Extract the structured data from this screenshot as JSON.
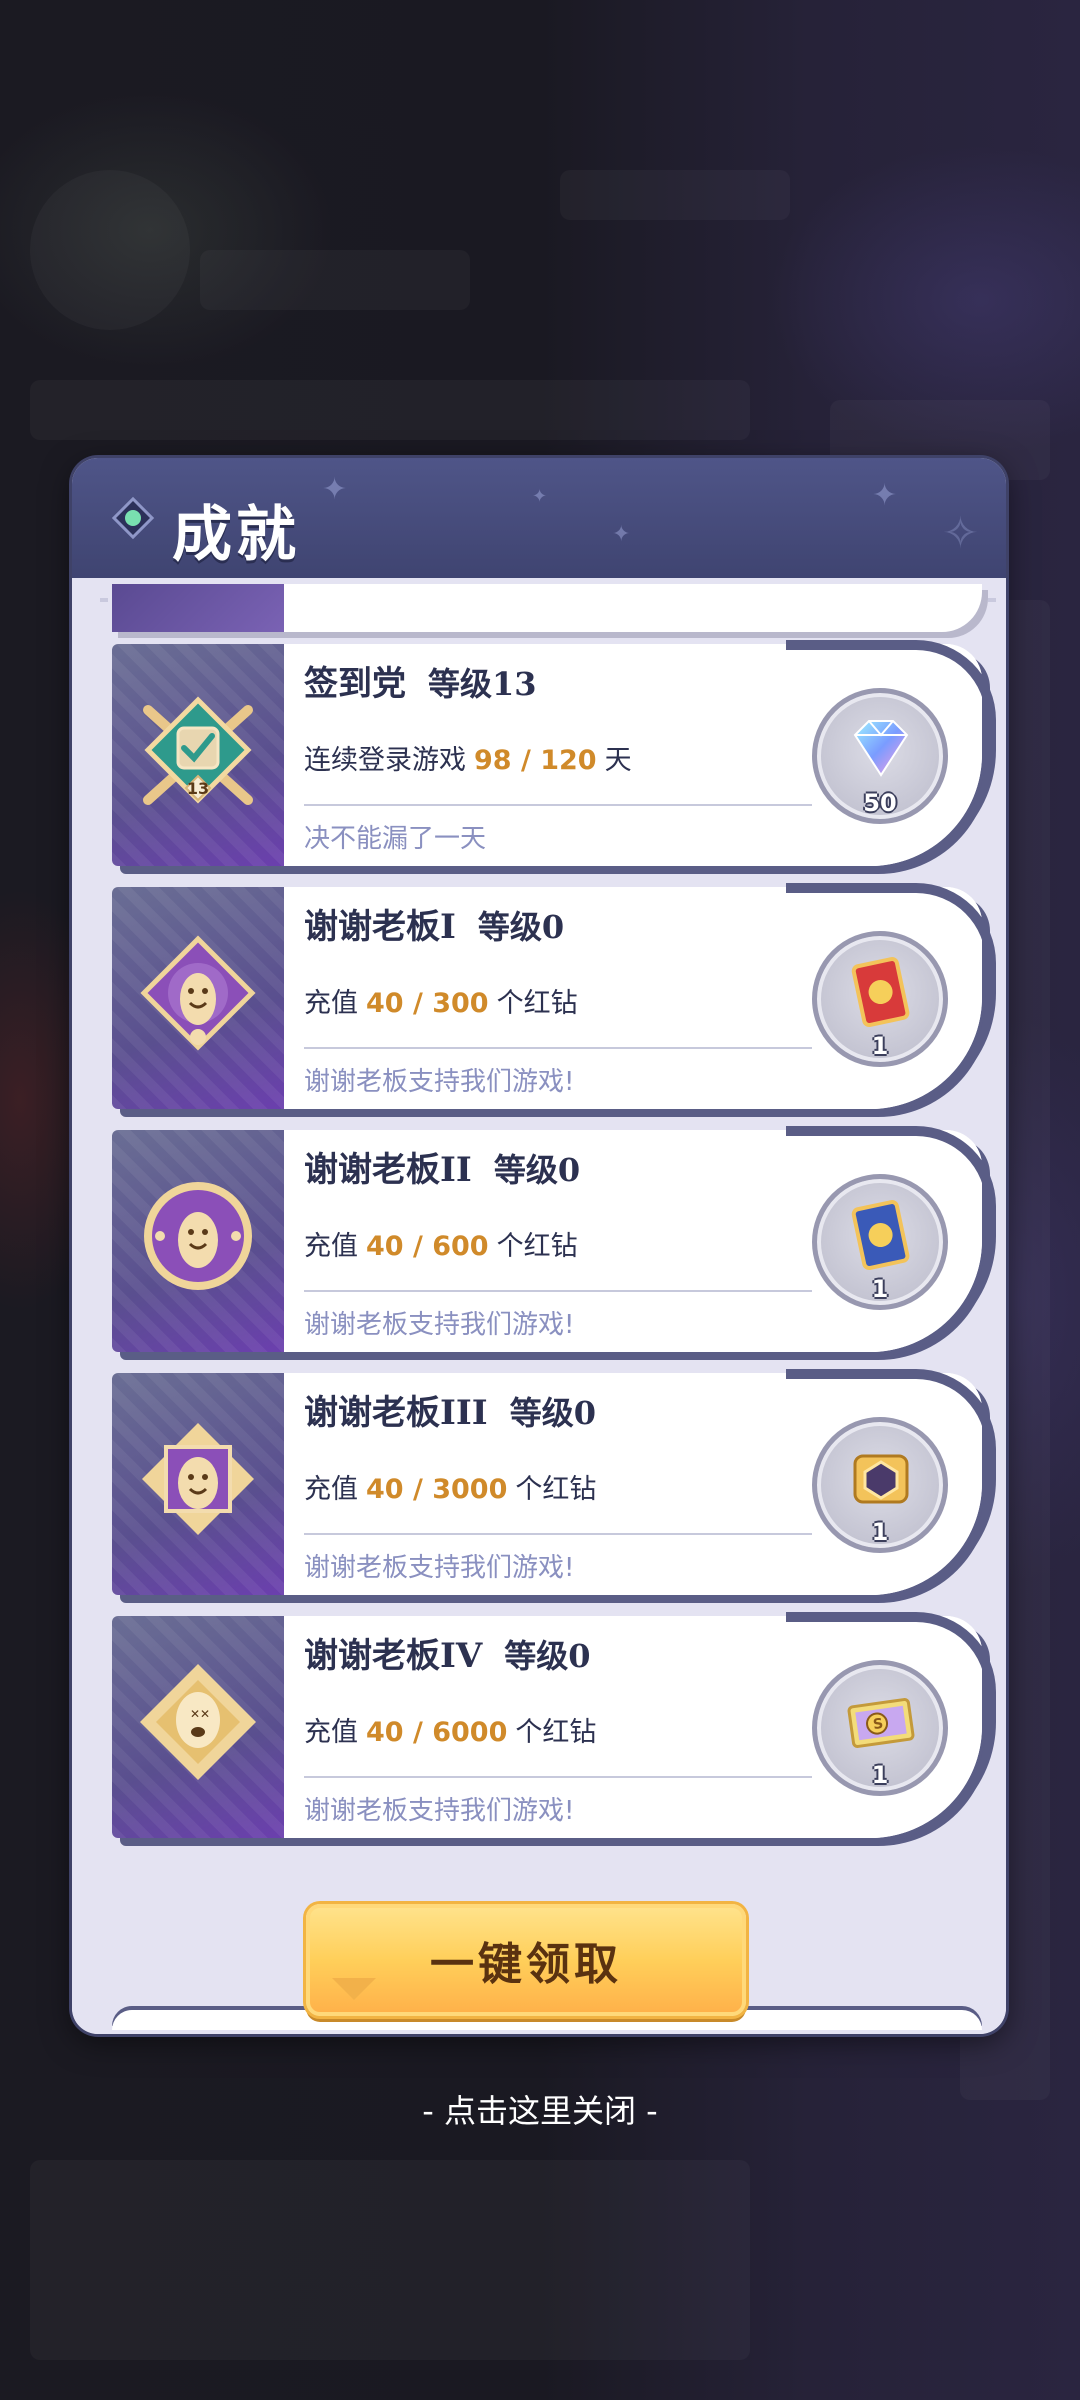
{
  "panel": {
    "title": "成就"
  },
  "achievements": [
    {
      "name": "签到党",
      "level": "等级13",
      "desc_prefix": "连续登录游戏",
      "progress": "98 / 120",
      "desc_suffix": "天",
      "flavor": "决不能漏了一天",
      "badge_label": "13",
      "badge_icon": "checkin-badge-icon",
      "reward_icon": "diamond-icon",
      "reward_count": "50"
    },
    {
      "name": "谢谢老板I",
      "level": "等级0",
      "desc_prefix": "充值",
      "progress": "40 / 300",
      "desc_suffix": "个红钻",
      "flavor": "谢谢老板支持我们游戏!",
      "badge_icon": "boss-badge-1-icon",
      "reward_icon": "red-card-icon",
      "reward_count": "1"
    },
    {
      "name": "谢谢老板II",
      "level": "等级0",
      "desc_prefix": "充值",
      "progress": "40 / 600",
      "desc_suffix": "个红钻",
      "flavor": "谢谢老板支持我们游戏!",
      "badge_icon": "boss-badge-2-icon",
      "reward_icon": "blue-card-icon",
      "reward_count": "1"
    },
    {
      "name": "谢谢老板III",
      "level": "等级0",
      "desc_prefix": "充值",
      "progress": "40 / 3000",
      "desc_suffix": "个红钻",
      "flavor": "谢谢老板支持我们游戏!",
      "badge_icon": "boss-badge-3-icon",
      "reward_icon": "gold-chest-icon",
      "reward_count": "1"
    },
    {
      "name": "谢谢老板IV",
      "level": "等级0",
      "desc_prefix": "充值",
      "progress": "40 / 6000",
      "desc_suffix": "个红钻",
      "flavor": "谢谢老板支持我们游戏!",
      "badge_icon": "boss-badge-4-icon",
      "reward_icon": "s-ticket-icon",
      "reward_count": "1"
    }
  ],
  "claim_all_label": "一键领取",
  "close_hint": "- 点击这里关闭 -",
  "colors": {
    "progress": "#d08a2a",
    "flavor": "#8a90c0",
    "header": "#4f5588",
    "button": "#ffcf5a"
  }
}
